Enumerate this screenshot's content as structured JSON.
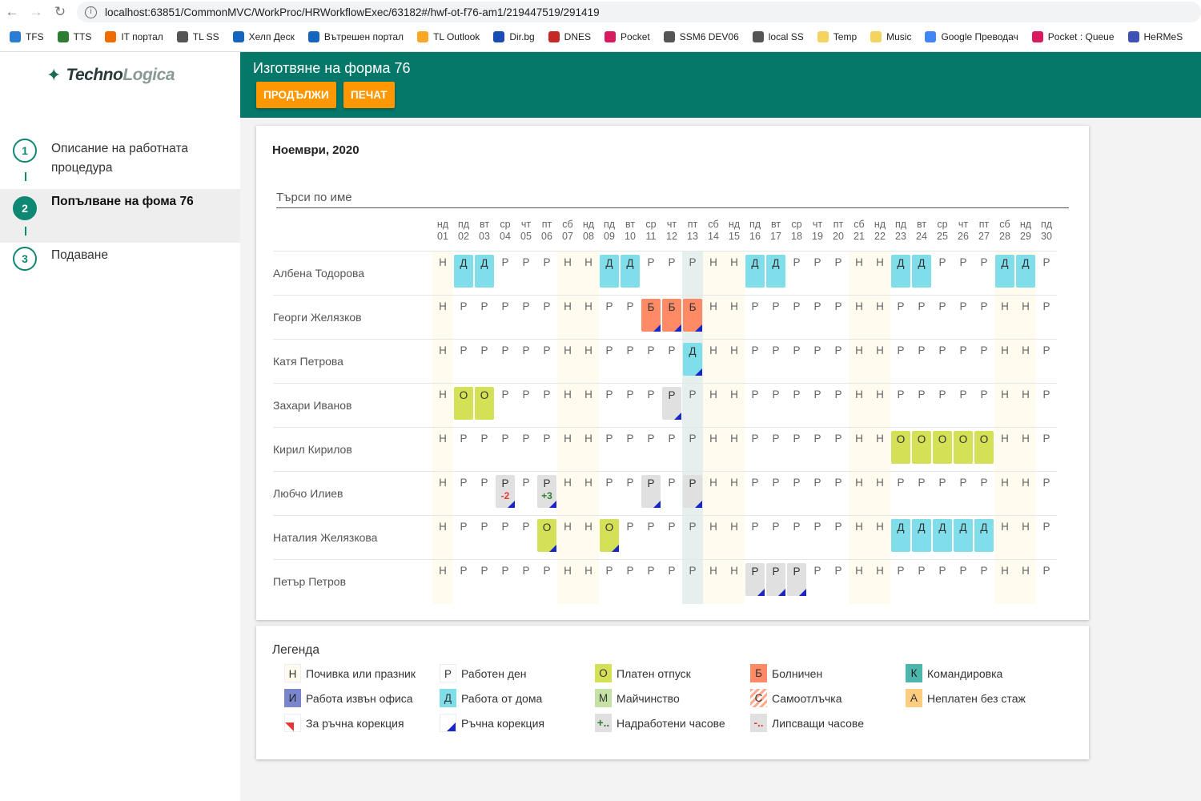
{
  "browser": {
    "url": "localhost:63851/CommonMVC/WorkProc/HRWorkflowExec/63182#/hwf-ot-f76-am1/219447519/291419",
    "bookmarks": [
      "TFS",
      "TTS",
      "IT портал",
      "TL SS",
      "Хелп Деск",
      "Вътрешен портал",
      "TL Outlook",
      "Dir.bg",
      "DNES",
      "Pocket",
      "SSM6 DEV06",
      "local SS",
      "Temp",
      "Music",
      "Google Преводач",
      "Pocket : Queue",
      "HeRMeS"
    ]
  },
  "logo": {
    "part1": "Techno",
    "part2": "Logica"
  },
  "steps": [
    {
      "num": "1",
      "label": "Описание на работната процедура"
    },
    {
      "num": "2",
      "label": "Попълване на фома 76"
    },
    {
      "num": "3",
      "label": "Подаване"
    }
  ],
  "header": {
    "title": "Изготвяне на форма 76",
    "continue_label": "ПРОДЪЛЖИ",
    "print_label": "ПЕЧАТ"
  },
  "calendar": {
    "month": "Ноември, 2020",
    "search_placeholder": "Търси по име",
    "weekdays": [
      "нд",
      "пд",
      "вт",
      "ср",
      "чт",
      "пт",
      "сб",
      "нд",
      "пд",
      "вт",
      "ср",
      "чт",
      "пт",
      "сб",
      "нд",
      "пд",
      "вт",
      "ср",
      "чт",
      "пт",
      "сб",
      "нд",
      "пд",
      "вт",
      "ср",
      "чт",
      "пт",
      "сб",
      "нд",
      "пд"
    ],
    "days": [
      "01",
      "02",
      "03",
      "04",
      "05",
      "06",
      "07",
      "08",
      "09",
      "10",
      "11",
      "12",
      "13",
      "14",
      "15",
      "16",
      "17",
      "18",
      "19",
      "20",
      "21",
      "22",
      "23",
      "24",
      "25",
      "26",
      "27",
      "28",
      "29",
      "30"
    ],
    "employees": [
      {
        "name": "Албена Тодорова",
        "cells": [
          "Н",
          "Д",
          "Д",
          "Р",
          "Р",
          "Р",
          "Н",
          "Н",
          "Д",
          "Д",
          "Р",
          "Р",
          "Р",
          "Н",
          "Н",
          "Д",
          "Д",
          "Р",
          "Р",
          "Р",
          "Н",
          "Н",
          "Д",
          "Д",
          "Р",
          "Р",
          "Р",
          "Д",
          "Д",
          "Р"
        ]
      },
      {
        "name": "Георги Желязков",
        "cells": [
          "Н",
          "Р",
          "Р",
          "Р",
          "Р",
          "Р",
          "Н",
          "Н",
          "Р",
          "Р",
          "Б",
          "Б",
          "Б",
          "Н",
          "Н",
          "Р",
          "Р",
          "Р",
          "Р",
          "Р",
          "Н",
          "Н",
          "Р",
          "Р",
          "Р",
          "Р",
          "Р",
          "Н",
          "Н",
          "Р"
        ]
      },
      {
        "name": "Катя Петрова",
        "cells": [
          "Н",
          "Р",
          "Р",
          "Р",
          "Р",
          "Р",
          "Н",
          "Н",
          "Р",
          "Р",
          "Р",
          "Р",
          "Д",
          "Н",
          "Н",
          "Р",
          "Р",
          "Р",
          "Р",
          "Р",
          "Н",
          "Н",
          "Р",
          "Р",
          "Р",
          "Р",
          "Р",
          "Н",
          "Н",
          "Р"
        ]
      },
      {
        "name": "Захари Иванов",
        "cells": [
          "Н",
          "О",
          "О",
          "Р",
          "Р",
          "Р",
          "Н",
          "Н",
          "Р",
          "Р",
          "Р",
          "Р",
          "Р",
          "Н",
          "Н",
          "Р",
          "Р",
          "Р",
          "Р",
          "Р",
          "Н",
          "Н",
          "Р",
          "Р",
          "Р",
          "Р",
          "Р",
          "Н",
          "Н",
          "Р"
        ]
      },
      {
        "name": "Кирил Кирилов",
        "cells": [
          "Н",
          "Р",
          "Р",
          "Р",
          "Р",
          "Р",
          "Н",
          "Н",
          "Р",
          "Р",
          "Р",
          "Р",
          "Р",
          "Н",
          "Н",
          "Р",
          "Р",
          "Р",
          "Р",
          "Р",
          "Н",
          "Н",
          "О",
          "О",
          "О",
          "О",
          "О",
          "Н",
          "Н",
          "Р"
        ]
      },
      {
        "name": "Любчо Илиев",
        "cells": [
          "Н",
          "Р",
          "Р",
          "Р",
          "Р",
          "Р",
          "Н",
          "Н",
          "Р",
          "Р",
          "Р",
          "Р",
          "Р",
          "Н",
          "Н",
          "Р",
          "Р",
          "Р",
          "Р",
          "Р",
          "Н",
          "Н",
          "Р",
          "Р",
          "Р",
          "Р",
          "Р",
          "Н",
          "Н",
          "Р"
        ]
      },
      {
        "name": "Наталия Желязкова",
        "cells": [
          "Н",
          "Р",
          "Р",
          "Р",
          "Р",
          "О",
          "Н",
          "Н",
          "О",
          "Р",
          "Р",
          "Р",
          "Р",
          "Н",
          "Н",
          "Р",
          "Р",
          "Р",
          "Р",
          "Р",
          "Н",
          "Н",
          "Д",
          "Д",
          "Д",
          "Д",
          "Д",
          "Н",
          "Н",
          "Р"
        ]
      },
      {
        "name": "Петър Петров",
        "cells": [
          "Н",
          "Р",
          "Р",
          "Р",
          "Р",
          "Р",
          "Н",
          "Н",
          "Р",
          "Р",
          "Р",
          "Р",
          "Р",
          "Н",
          "Н",
          "Р",
          "Р",
          "Р",
          "Р",
          "Р",
          "Н",
          "Н",
          "Р",
          "Р",
          "Р",
          "Р",
          "Р",
          "Н",
          "Н",
          "Р"
        ]
      }
    ],
    "marked": [
      [
        "1.10",
        "1.11",
        "1.12"
      ],
      [
        "2.12"
      ],
      [
        "3.11"
      ],
      [],
      [
        "5.3",
        "5.5",
        "5.10",
        "5.12"
      ],
      [
        "6.5",
        "6.8"
      ],
      [
        "7.15",
        "7.16",
        "7.17"
      ]
    ],
    "grey_tiles": [
      "3.11",
      "5.3",
      "5.5",
      "5.10",
      "5.12",
      "7.15",
      "7.16",
      "7.17"
    ],
    "hours_adjust": [
      {
        "row": 5,
        "day": 3,
        "value": "-2"
      },
      {
        "row": 5,
        "day": 5,
        "value": "+3"
      }
    ],
    "today_index": 12
  },
  "legend": {
    "title": "Легенда",
    "items": [
      {
        "code": "Н",
        "label": "Почивка или празник",
        "bg": "#fffbee"
      },
      {
        "code": "Р",
        "label": "Работен ден",
        "bg": "#ffffff"
      },
      {
        "code": "О",
        "label": "Платен отпуск",
        "bg": "#d4e157"
      },
      {
        "code": "Б",
        "label": "Болничен",
        "bg": "#ff8a65"
      },
      {
        "code": "К",
        "label": "Командировка",
        "bg": "#4db6ac"
      },
      {
        "code": "И",
        "label": "Работа извън офиса",
        "bg": "#7986cb"
      },
      {
        "code": "Д",
        "label": "Работа от дома",
        "bg": "#80deea"
      },
      {
        "code": "М",
        "label": "Майчинство",
        "bg": "#c5e1a5"
      },
      {
        "code": "С",
        "label": "Самоотлъчка",
        "bg": "stripes"
      },
      {
        "code": "А",
        "label": "Неплатен без стаж",
        "bg": "#ffcc80"
      },
      {
        "code": "",
        "label": "За ръчна корекция",
        "bg": "corner-red"
      },
      {
        "code": "",
        "label": "Ръчна корекция",
        "bg": "corner-blue"
      },
      {
        "code": "+..",
        "label": "Надработени часове",
        "bg": "#e0e0e0"
      },
      {
        "code": "-..",
        "label": "Липсващи часове",
        "bg": "#e0e0e0"
      }
    ]
  },
  "colors": {
    "teal": "#05786a",
    "orange": "#ff9800",
    "Д": "#80deea",
    "О": "#d4e157",
    "Б": "#ff8a65",
    "grey": "#e0e0e0"
  }
}
